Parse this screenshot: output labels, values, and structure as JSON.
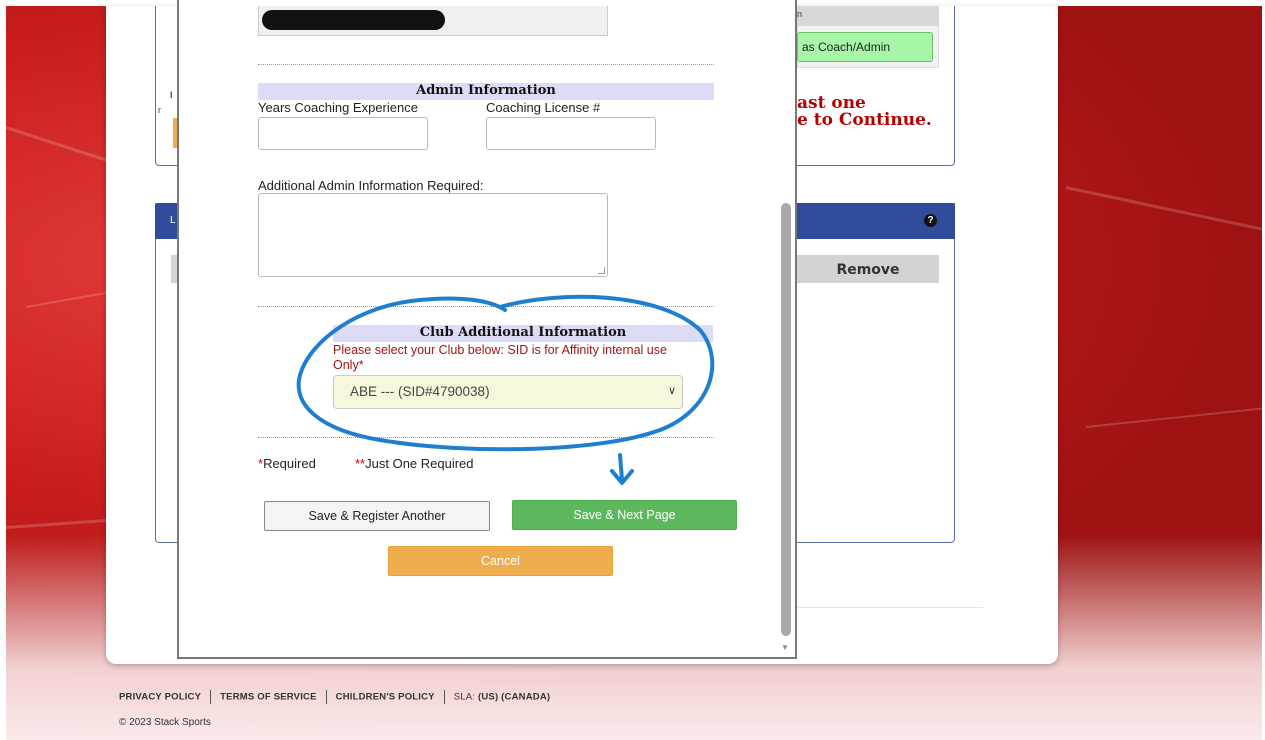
{
  "background_panel": {
    "green_button_label": "as Coach/Admin",
    "warning_line1": "ast one",
    "warning_line2": "e to Continue.",
    "remove_header": "Remove",
    "help_icon": "question-circle-icon",
    "left_stub_text_1": "I",
    "left_stub_text_2": "r",
    "left_stub_text_3": "L",
    "top_stub_text": "n"
  },
  "modal": {
    "admin_section_title": "Admin Information",
    "years_label": "Years Coaching Experience",
    "years_value": "",
    "license_label": "Coaching License #",
    "license_value": "",
    "additional_label": "Additional Admin Information Required:",
    "additional_value": "",
    "club_section_title": "Club Additional Information",
    "club_label": "Please select your Club below: SID is for Affinity internal use Only",
    "club_label_star": "*",
    "club_selected": "ABE --- (SID#4790038)",
    "required_star": "*",
    "required_text": "Required",
    "just_one_star": "**",
    "just_one_text": "Just One Required",
    "save_register_label": "Save & Register Another",
    "save_next_label": "Save & Next Page",
    "cancel_label": "Cancel"
  },
  "footer": {
    "links": [
      "PRIVACY POLICY",
      "TERMS OF SERVICE",
      "CHILDREN'S POLICY"
    ],
    "sla_label": "SLA:",
    "sla_us": "(US)",
    "sla_canada": "(CANADA)",
    "copyright": "© 2023 Stack Sports"
  },
  "colors": {
    "annotation_blue": "#1e7fd1",
    "save_next_green": "#5cb85c",
    "cancel_orange": "#f0ad4e",
    "error_red": "#b30000"
  }
}
